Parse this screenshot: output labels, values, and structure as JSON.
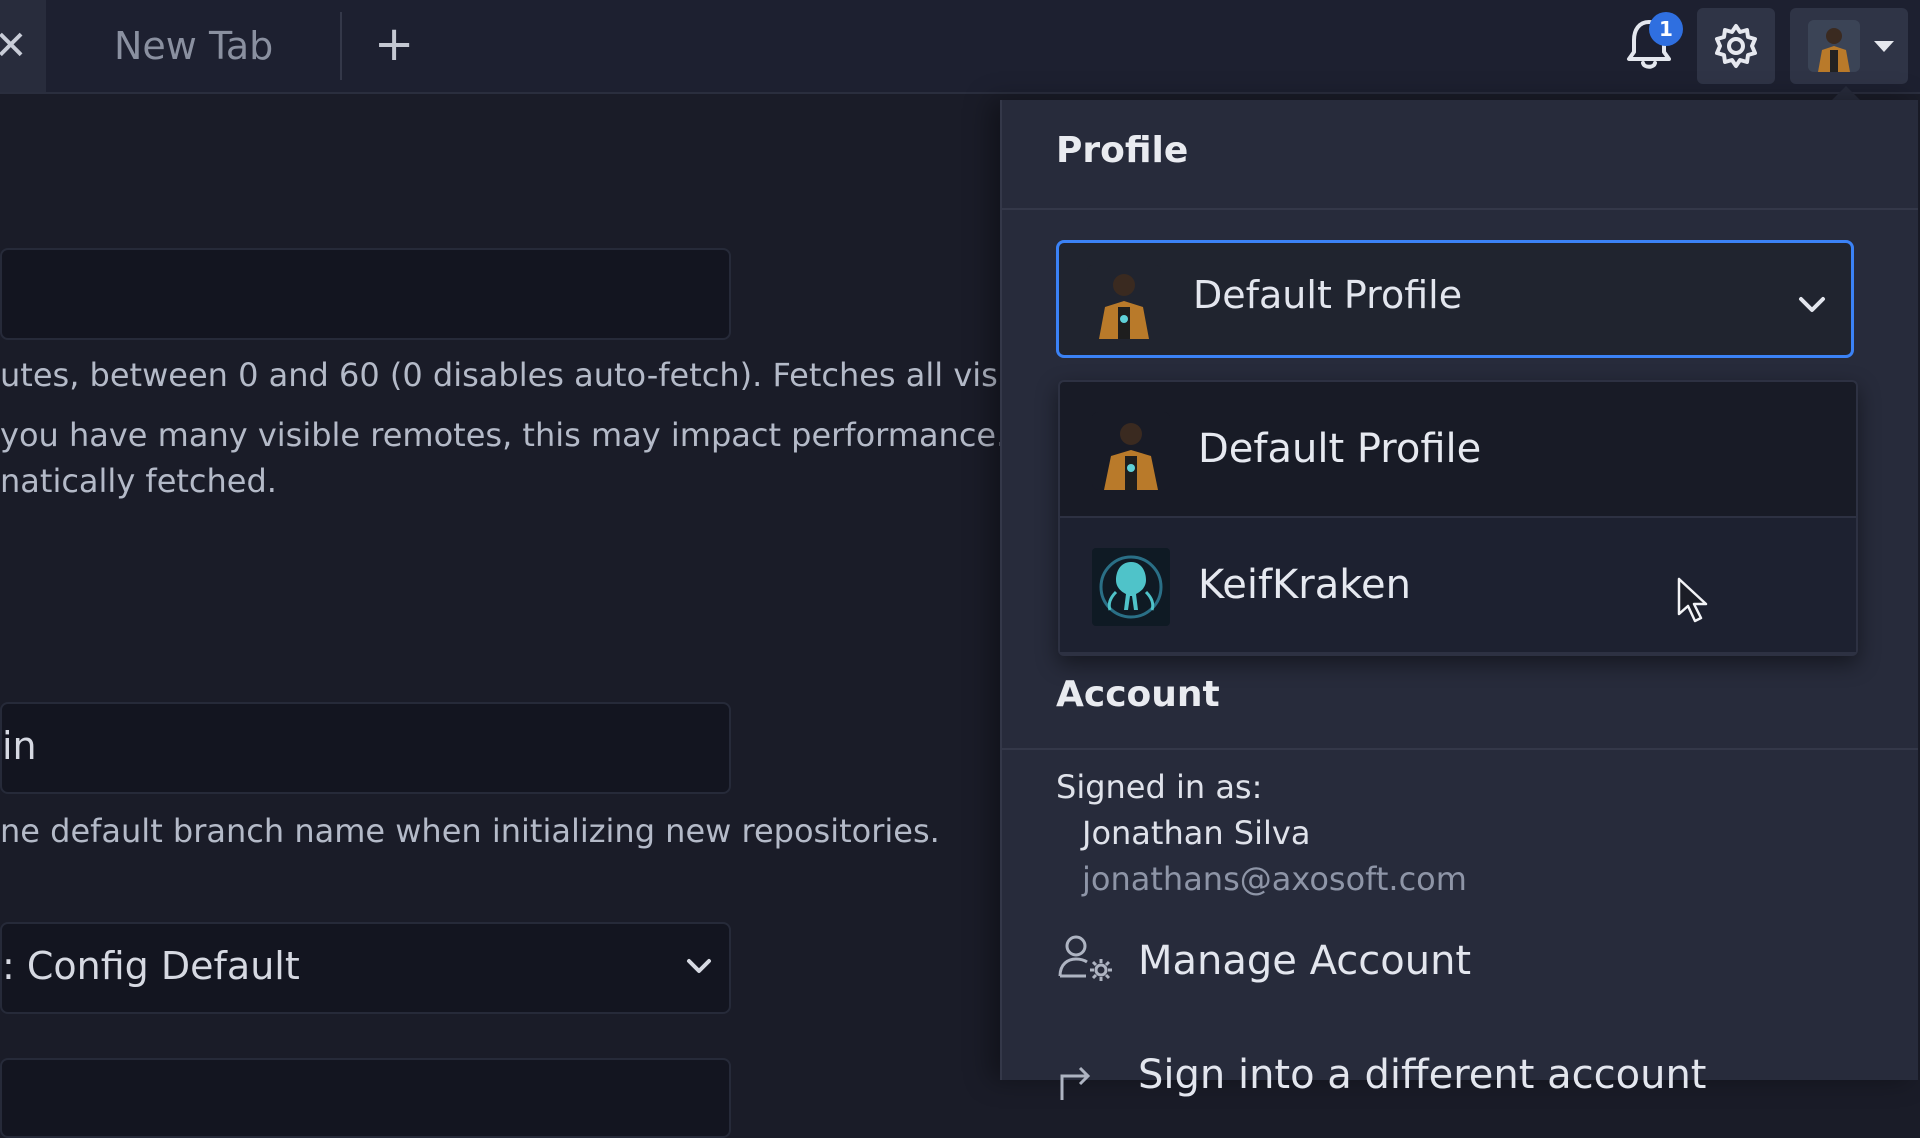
{
  "tabs": {
    "close_glyph": "✕",
    "new_tab_label": "New Tab",
    "add_glyph": "+"
  },
  "header": {
    "notification_count": "1",
    "icons": {
      "bell": "bell-icon",
      "gear": "gear-icon",
      "profile_caret": "caret-down-icon"
    }
  },
  "settings": {
    "fetch_help_line1": "utes, between 0 and 60 (0 disables auto-fetch). Fetches all visible",
    "fetch_help_line2": "you have many visible remotes, this may impact performance. LFS",
    "fetch_help_line3": "natically fetched.",
    "default_branch_value": "in",
    "default_branch_help": "ne default branch name when initializing new repositories.",
    "config_select_value": ": Config Default"
  },
  "profile_panel": {
    "title": "Profile",
    "selected_profile": "Default Profile",
    "options": [
      {
        "label": "Default Profile"
      },
      {
        "label": "KeifKraken"
      }
    ],
    "account_title": "Account",
    "signed_in_label": "Signed in as:",
    "user_name": "Jonathan Silva",
    "user_email": "jonathans@axosoft.com",
    "manage_account_label": "Manage Account",
    "switch_account_label": "Sign into a different account"
  },
  "colors": {
    "accent": "#3b82f6",
    "badge": "#2f6fe0",
    "panel_bg": "#272b3b",
    "page_bg": "#1a1c28"
  }
}
